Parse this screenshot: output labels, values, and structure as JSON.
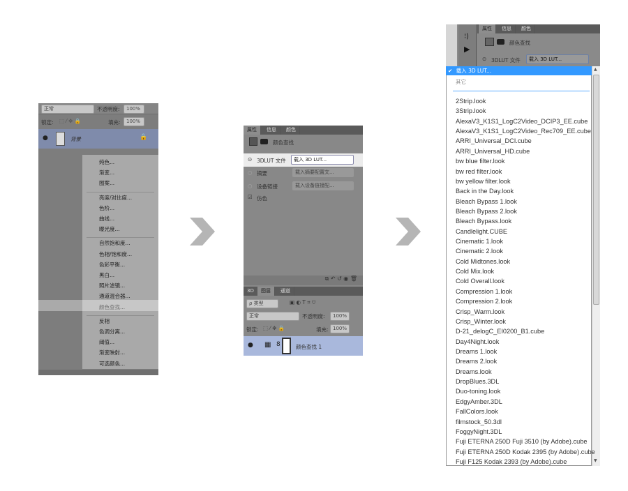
{
  "left_panel": {
    "blend_mode": "正常",
    "opacity_label": "不透明度:",
    "opacity_value": "100%",
    "lock_label": "锁定:",
    "fill_label": "填充:",
    "fill_value": "100%",
    "layer_name": "背景",
    "menu_groups": [
      [
        "纯色...",
        "渐变...",
        "图案..."
      ],
      [
        "亮度/对比度...",
        "色阶...",
        "曲线...",
        "曝光度..."
      ],
      [
        "自然饱和度...",
        "色相/饱和度...",
        "色彩平衡...",
        "黑白...",
        "照片滤镜...",
        "通道混合器...",
        "颜色查找..."
      ],
      [
        "反相",
        "色调分离...",
        "阈值...",
        "渐变映射...",
        "可选颜色..."
      ]
    ],
    "highlighted_item": "颜色查找..."
  },
  "middle_panel": {
    "tabs": [
      "属性",
      "信息",
      "颜色"
    ],
    "panel_title": "颜色查找",
    "lut_label": "3DLUT 文件",
    "lut_select": "载入 3D LUT...",
    "abstract_label": "摘要",
    "abstract_select": "载入摘要配置文...",
    "device_label": "设备链接",
    "device_select": "载入设备链接配...",
    "dither_label": "仿色",
    "dither_checked": true,
    "layer_tabs": [
      "3D",
      "图层",
      "通道"
    ],
    "filter_label": "ρ 类型",
    "blend_mode": "正常",
    "opacity_label": "不透明度:",
    "opacity_value": "100%",
    "lock_label": "锁定:",
    "fill_label": "填充:",
    "fill_value": "100%",
    "layer_name": "颜色查找 1"
  },
  "right_panel": {
    "tabs": [
      "属性",
      "信息",
      "颜色"
    ],
    "panel_title": "颜色查找",
    "lut_label": "3DLUT 文件",
    "lut_select": "载入 3D LUT...",
    "selected_option": "载入 3D LUT...",
    "other_option": "其它",
    "lut_files": [
      "2Strip.look",
      "3Strip.look",
      "AlexaV3_K1S1_LogC2Video_DCIP3_EE.cube",
      "AlexaV3_K1S1_LogC2Video_Rec709_EE.cube",
      "ARRI_Universal_DCI.cube",
      "ARRI_Universal_HD.cube",
      "bw blue filter.look",
      "bw red filter.look",
      "bw yellow filter.look",
      "Back in the Day.look",
      "Bleach Bypass 1.look",
      "Bleach Bypass 2.look",
      "Bleach Bypass.look",
      "Candlelight.CUBE",
      "Cinematic 1.look",
      "Cinematic 2.look",
      "Cold Midtones.look",
      "Cold Mix.look",
      "Cold Overall.look",
      "Compression 1.look",
      "Compression 2.look",
      "Crisp_Warm.look",
      "Crisp_Winter.look",
      "D-21_delogC_EI0200_B1.cube",
      "Day4Night.look",
      "Dreams 1.look",
      "Dreams 2.look",
      "Dreams.look",
      "DropBlues.3DL",
      "Duo-toning.look",
      "EdgyAmber.3DL",
      "FallColors.look",
      "filmstock_50.3dl",
      "FoggyNight.3DL",
      "Fuji ETERNA 250D Fuji 3510 (by Adobe).cube",
      "Fuji ETERNA 250D Kodak 2395 (by Adobe).cube",
      "Fuji F125 Kodak 2393 (by Adobe).cube"
    ]
  },
  "colors": {
    "selection_blue": "#3399ff",
    "layer_blue": "#a9b8dc",
    "arrow_gray": "#b5b5b5"
  }
}
